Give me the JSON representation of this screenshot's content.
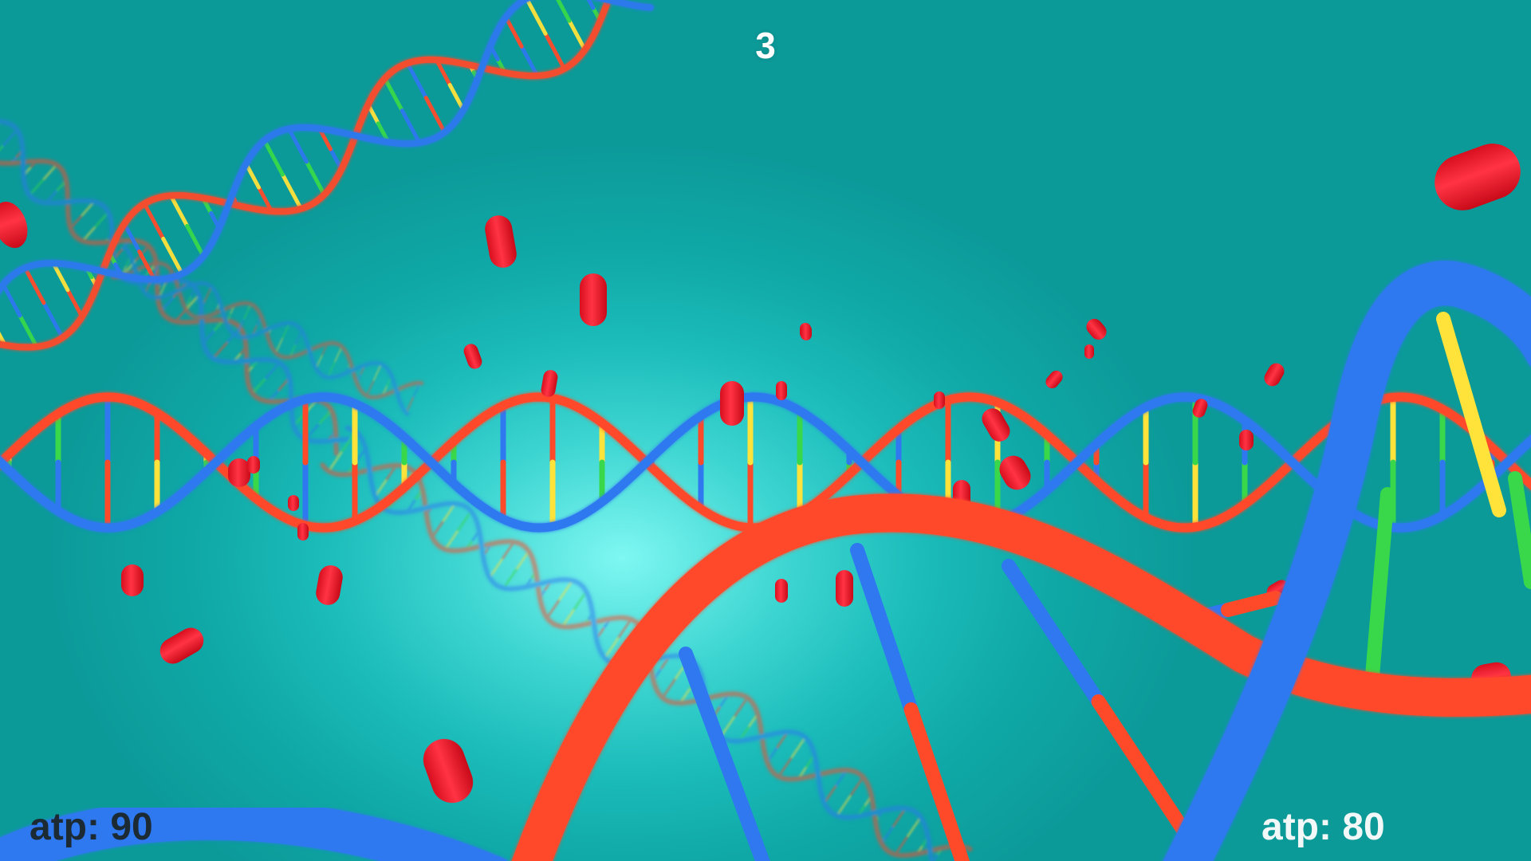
{
  "game": {
    "round_counter": "3",
    "player_left": {
      "atp_text": "atp: 90",
      "atp_value": 90
    },
    "player_right": {
      "atp_text": "atp: 80",
      "atp_value": 80
    }
  },
  "colors": {
    "background_center": "#7ff7f2",
    "background_edge": "#0c9a99",
    "strand_red": "#ff4a2a",
    "strand_blue": "#2f78f0",
    "base_yellow": "#ffe23a",
    "base_green": "#38d84a",
    "atp_molecule": "#ff1e2d",
    "left_label": "#1c2a33",
    "right_label": "#f2f7f7"
  },
  "icons": {
    "atp_molecule": "red-capsule-icon",
    "dna_helix": "double-helix-icon"
  }
}
